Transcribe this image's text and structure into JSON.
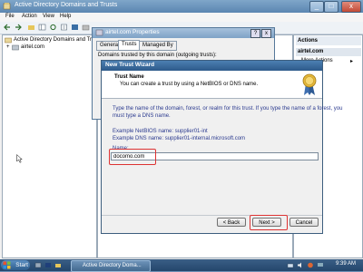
{
  "main_window": {
    "title": "Active Directory Domains and Trusts",
    "menu": [
      "File",
      "Action",
      "View",
      "Help"
    ],
    "tree": {
      "root": "Active Directory Domains and Trusts",
      "child": "airtel.com"
    },
    "actions": {
      "title": "Actions",
      "section": "airtel.com",
      "item": "More Actions"
    }
  },
  "properties_dialog": {
    "title": "airtel.com Properties",
    "tabs": [
      "General",
      "Trusts",
      "Managed By"
    ],
    "domains_label": "Domains trusted by this domain (outgoing trusts):"
  },
  "wizard": {
    "title": "New Trust Wizard",
    "heading": "Trust Name",
    "subheading": "You can create a trust by using a NetBIOS or DNS name.",
    "instruction_line1": "Type the name of the domain, forest, or realm for this trust. If you type the name of a forest, you",
    "instruction_line2": "must type a DNS name.",
    "example_netbios": "Example NetBIOS name: supplier01-int",
    "example_dns": "Example DNS name: supplier01-internal.microsoft.com",
    "name_label": "Name:",
    "name_value": "docomo.com",
    "back_button": "< Back",
    "next_button": "Next >",
    "cancel_button": "Cancel"
  },
  "taskbar": {
    "start_label": "Start",
    "task_item": "Active Directory Doma...",
    "clock": "9:39 AM"
  },
  "colors": {
    "highlight": "#dd3333",
    "titlebar": "#5b86b1",
    "wizard_titlebar": "#2d5a8a"
  }
}
